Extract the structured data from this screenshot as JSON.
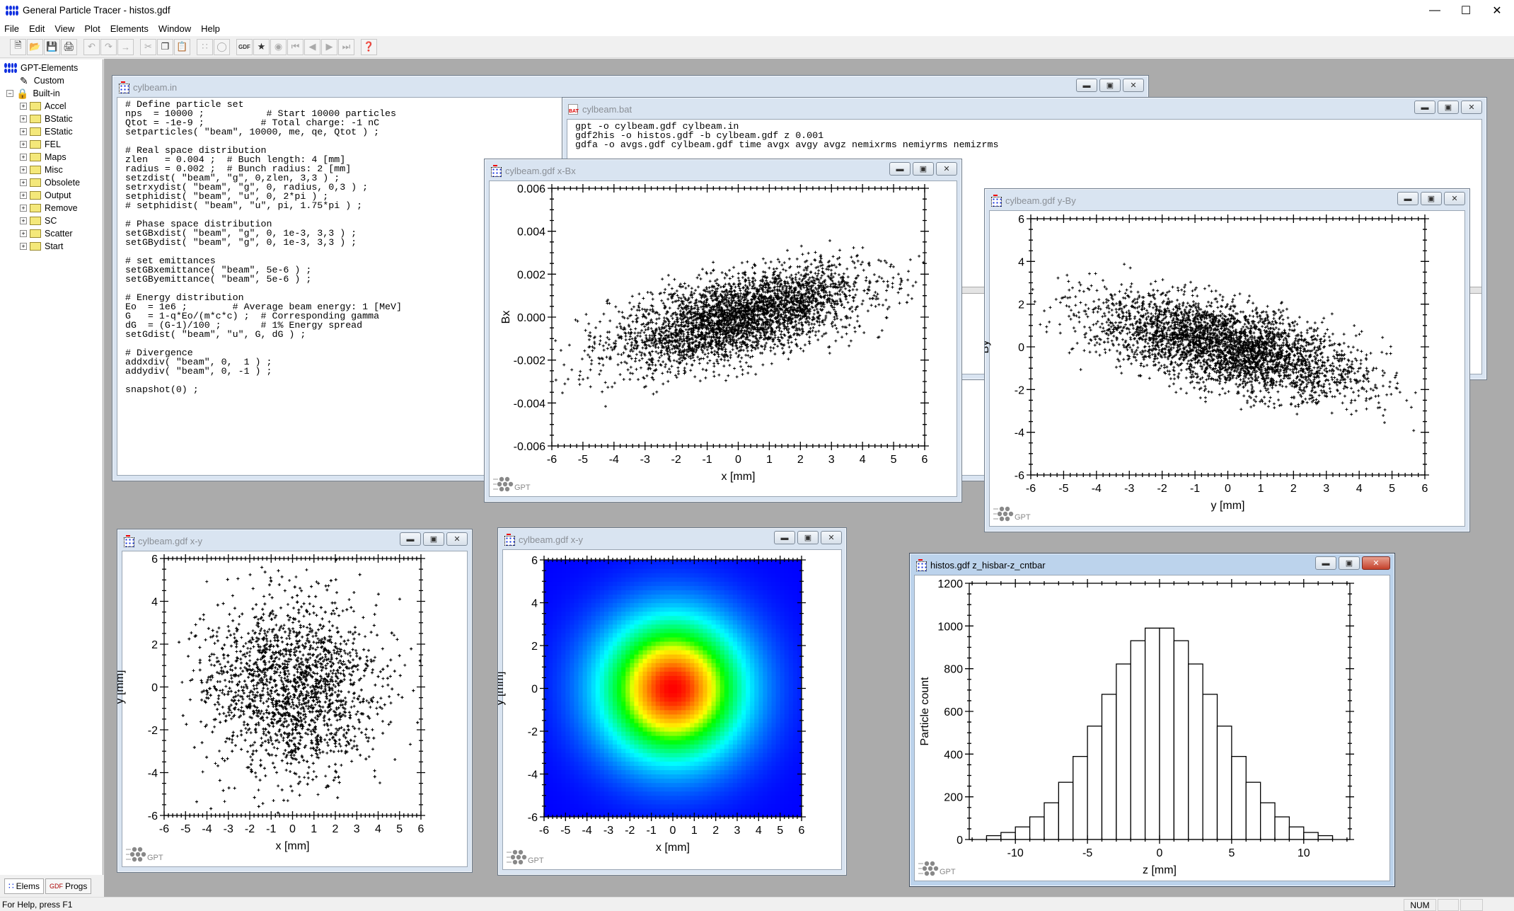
{
  "app": {
    "title": "General Particle Tracer - histos.gdf",
    "menu": [
      "File",
      "Edit",
      "View",
      "Plot",
      "Elements",
      "Window",
      "Help"
    ],
    "toolbar": [
      "new",
      "open",
      "save",
      "print",
      "undo",
      "redo",
      "renumber",
      "cut",
      "copy",
      "paste",
      "run",
      "stop",
      "gdf-plot",
      "new-plot",
      "record",
      "first",
      "previous",
      "next",
      "last",
      "context-help"
    ],
    "toolbar_gdf_label": "GDF",
    "status": "For Help, press F1",
    "status_num": "NUM"
  },
  "sidebar": {
    "root": "GPT-Elements",
    "custom": "Custom",
    "builtin": "Built-in",
    "folders": [
      "Accel",
      "BStatic",
      "EStatic",
      "FEL",
      "Maps",
      "Misc",
      "Obsolete",
      "Output",
      "Remove",
      "SC",
      "Scatter",
      "Start"
    ],
    "tabs": [
      "Elems",
      "Progs"
    ]
  },
  "windows": {
    "input": {
      "title": "cylbeam.in",
      "lines": [
        "# Define particle set",
        "nps  = 10000 ;           # Start 10000 particles",
        "Qtot = -1e-9 ;          # Total charge: -1 nC",
        "setparticles( \"beam\", 10000, me, qe, Qtot ) ;",
        "",
        "# Real space distribution",
        "zlen   = 0.004 ;  # Buch length: 4 [mm]",
        "radius = 0.002 ;  # Bunch radius: 2 [mm]",
        "setzdist( \"beam\", \"g\", 0,zlen, 3,3 ) ;",
        "setrxydist( \"beam\", \"g\", 0, radius, 0,3 ) ;",
        "setphidist( \"beam\", \"u\", 0, 2*pi ) ;",
        "# setphidist( \"beam\", \"u\", pi, 1.75*pi ) ;",
        "",
        "# Phase space distribution",
        "setGBxdist( \"beam\", \"g\", 0, 1e-3, 3,3 ) ;",
        "setGBydist( \"beam\", \"g\", 0, 1e-3, 3,3 ) ;",
        "",
        "# set emittances",
        "setGBxemittance( \"beam\", 5e-6 ) ;",
        "setGByemittance( \"beam\", 5e-6 ) ;",
        "",
        "# Energy distribution",
        "Eo  = 1e6 ;        # Average beam energy: 1 [MeV]",
        "G   = 1-q*Eo/(m*c*c) ;  # Corresponding gamma",
        "dG  = (G-1)/100 ;       # 1% Energy spread",
        "setGdist( \"beam\", \"u\", G, dG ) ;",
        "",
        "# Divergence",
        "addxdiv( \"beam\", 0,  1 ) ;",
        "addydiv( \"beam\", 0, -1 ) ;",
        "",
        "snapshot(0) ;"
      ]
    },
    "batch": {
      "title": "cylbeam.bat",
      "lines": [
        "gpt -o cylbeam.gdf cylbeam.in",
        "gdf2his -o histos.gdf -b cylbeam.gdf z 0.001",
        "gdfa -o avgs.gdf cylbeam.gdf time avgx avgy avgz nemixrms nemiyrms nemizrms"
      ]
    },
    "xbx": {
      "title": "cylbeam.gdf x-Bx"
    },
    "yby": {
      "title": "cylbeam.gdf y-By"
    },
    "xy": {
      "title": "cylbeam.gdf x-y"
    },
    "xyden": {
      "title": "cylbeam.gdf x-y"
    },
    "hist": {
      "title": "histos.gdf z_hisbar-z_cntbar"
    }
  },
  "logo_text": "GPT",
  "chart_data": [
    {
      "id": "xbx",
      "type": "scatter",
      "xlabel": "x [mm]",
      "ylabel": "Bx",
      "xlim": [
        -6,
        6
      ],
      "ylim": [
        -0.006,
        0.006
      ],
      "xticks": [
        "-6",
        "-5",
        "-4",
        "-3",
        "-2",
        "-1",
        "0",
        "1",
        "2",
        "3",
        "4",
        "5",
        "6"
      ],
      "yticks": [
        "-0.006",
        "-0.004",
        "-0.002",
        "0.000",
        "0.002",
        "0.004",
        "0.006"
      ],
      "correlation": "positive",
      "marker": "+",
      "color": "#000000"
    },
    {
      "id": "yby",
      "type": "scatter",
      "xlabel": "y [mm]",
      "ylabel": "By",
      "xlim": [
        -6,
        6
      ],
      "ylim": [
        -6,
        6
      ],
      "xticks": [
        "-6",
        "-5",
        "-4",
        "-3",
        "-2",
        "-1",
        "0",
        "1",
        "2",
        "3",
        "4",
        "5",
        "6"
      ],
      "yticks": [
        "-6",
        "-4",
        "-2",
        "0",
        "2",
        "4",
        "6"
      ],
      "correlation": "negative",
      "marker": "+",
      "color": "#000000"
    },
    {
      "id": "xy",
      "type": "scatter",
      "xlabel": "x [mm]",
      "ylabel": "y [mm]",
      "xlim": [
        -6,
        6
      ],
      "ylim": [
        -6,
        6
      ],
      "xticks": [
        "-6",
        "-5",
        "-4",
        "-3",
        "-2",
        "-1",
        "0",
        "1",
        "2",
        "3",
        "4",
        "5",
        "6"
      ],
      "yticks": [
        "-6",
        "-4",
        "-2",
        "0",
        "2",
        "4",
        "6"
      ],
      "correlation": "none",
      "marker": "+",
      "color": "#000000"
    },
    {
      "id": "xyden",
      "type": "heatmap",
      "xlabel": "x [mm]",
      "ylabel": "y [mm]",
      "xlim": [
        -6,
        6
      ],
      "ylim": [
        -6,
        6
      ],
      "xticks": [
        "-6",
        "-5",
        "-4",
        "-3",
        "-2",
        "-1",
        "0",
        "1",
        "2",
        "3",
        "4",
        "5",
        "6"
      ],
      "yticks": [
        "-6",
        "-4",
        "-2",
        "0",
        "2",
        "4",
        "6"
      ],
      "colormap": "jet",
      "peak": [
        0,
        0
      ]
    },
    {
      "id": "hist",
      "type": "bar",
      "xlabel": "z [mm]",
      "ylabel": "Particle count",
      "xlim": [
        -13.2,
        13.2
      ],
      "ylim": [
        0,
        1200
      ],
      "xticks": [
        "-10",
        "-5",
        "0",
        "5",
        "10"
      ],
      "yticks": [
        "0",
        "200",
        "400",
        "600",
        "800",
        "1000",
        "1200"
      ],
      "bin_edges": [
        -12,
        -11,
        -10,
        -9,
        -8,
        -7,
        -6,
        -5,
        -4,
        -3,
        -2,
        -1,
        0,
        1,
        2,
        3,
        4,
        5,
        6,
        7,
        8,
        9,
        10,
        11,
        12
      ],
      "values": [
        18,
        33,
        59,
        106,
        172,
        268,
        389,
        531,
        680,
        822,
        931,
        990,
        990,
        931,
        822,
        680,
        531,
        389,
        268,
        172,
        106,
        59,
        33,
        18
      ]
    }
  ]
}
